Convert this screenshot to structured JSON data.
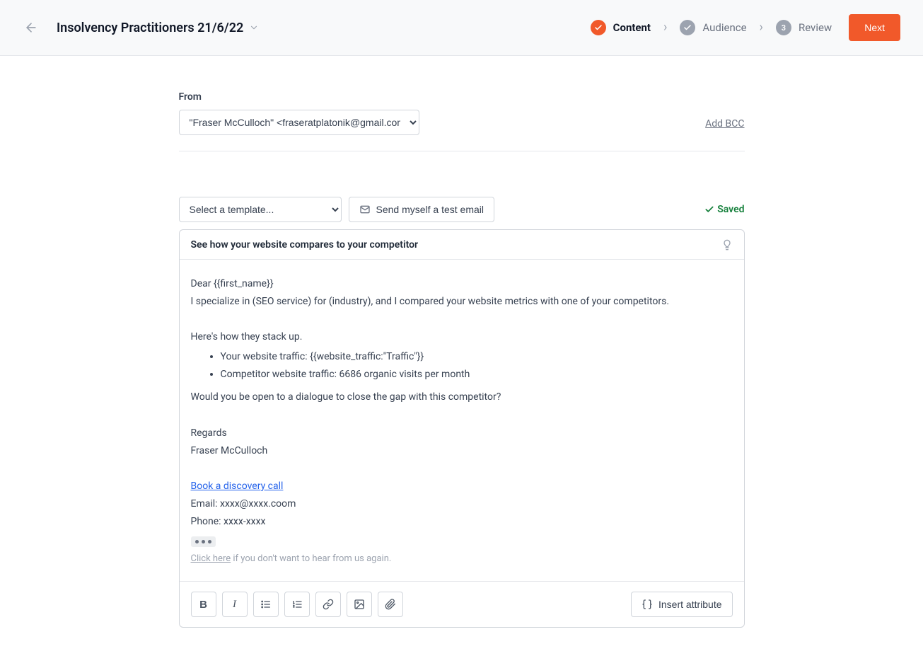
{
  "header": {
    "title": "Insolvency Practitioners 21/6/22",
    "steps": [
      {
        "label": "Content",
        "badge": "check"
      },
      {
        "label": "Audience",
        "badge": "check"
      },
      {
        "label": "Review",
        "badge": "3"
      }
    ],
    "next_label": "Next"
  },
  "from": {
    "label": "From",
    "value": "\"Fraser McCulloch\" <fraseratplatonik@gmail.com",
    "add_bcc": "Add BCC"
  },
  "template": {
    "placeholder": "Select a template...",
    "test_email_label": "Send myself a test email",
    "saved_label": "Saved"
  },
  "subject": "See how your website compares to your competitor",
  "body": {
    "greeting": "Dear {{first_name}}",
    "intro": "I specialize in (SEO service) for (industry), and I compared your website metrics with one of your competitors.",
    "stack_intro": "Here's how they stack up.",
    "bullets": [
      "Your website traffic: {{website_traffic:\"Traffic\"}}",
      "Competitor website traffic: 6686 organic visits  per month"
    ],
    "question": "Would you be open to a dialogue to close the gap with this competitor?",
    "regards": "Regards",
    "sender_name": "Fraser McCulloch",
    "cta_link": "Book a discovery call",
    "email_line": "Email: xxxx@xxxx.coom",
    "phone_line": "Phone: xxxx-xxxx",
    "unsub_click": "Click here",
    "unsub_rest": " if you don't want to hear from us again."
  },
  "toolbar": {
    "insert_attr_label": "Insert attribute"
  }
}
